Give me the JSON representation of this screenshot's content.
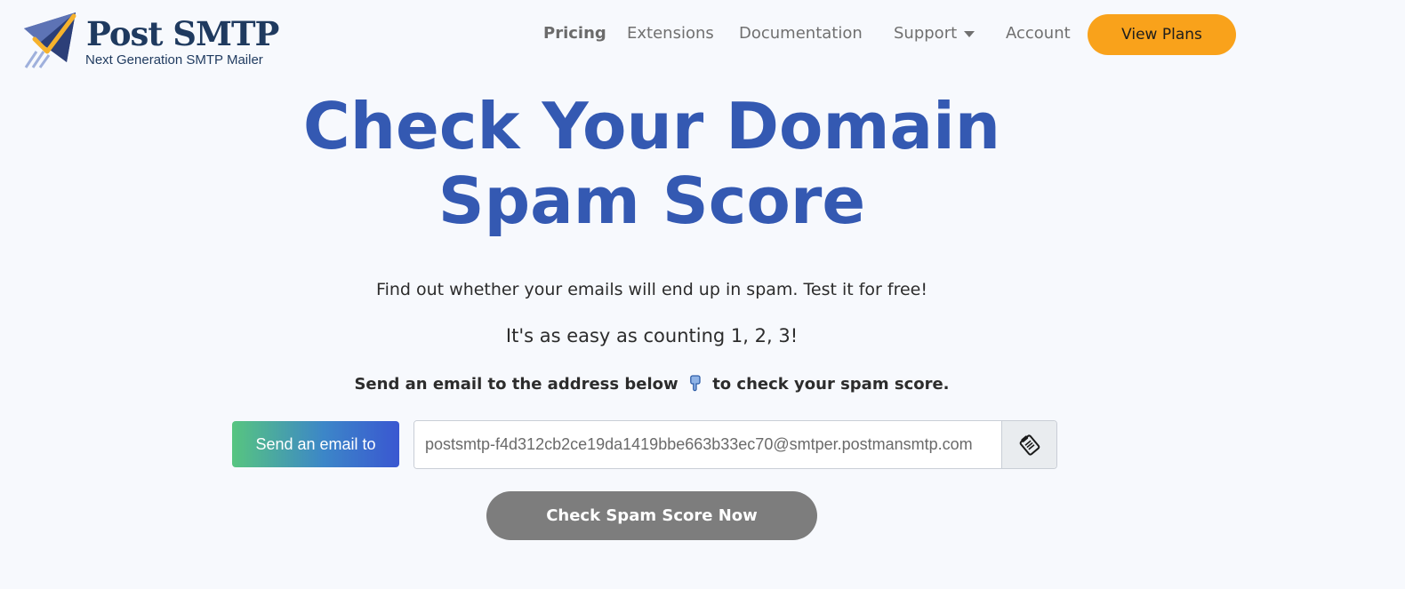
{
  "logo": {
    "title": "Post SMTP",
    "tagline": "Next Generation SMTP Mailer"
  },
  "nav": {
    "items": [
      {
        "label": "Pricing"
      },
      {
        "label": "Extensions"
      },
      {
        "label": "Documentation"
      },
      {
        "label": "Support"
      },
      {
        "label": "Account"
      }
    ],
    "cta": "View Plans"
  },
  "hero": {
    "title_line1": "Check Your Domain",
    "title_line2": "Spam Score",
    "subtitle": "Find out whether your emails will end up in spam. Test it for free!",
    "easy": "It's as easy as counting 1, 2, 3!",
    "instruction_before": "Send an email to the address below",
    "instruction_after": "to check your spam score."
  },
  "form": {
    "send_label": "Send an email to",
    "email_value": "postsmtp-f4d312cb2ce19da1419bbe663b33ec70@smtper.postmansmtp.com",
    "check_button": "Check Spam Score Now"
  },
  "colors": {
    "accent": "#3459b2",
    "cta": "#f9a21b",
    "button_gray": "#7d7d7d",
    "background": "#f7f9fd"
  },
  "icons": {
    "logo": "paper-plane-logo-icon",
    "hand": "hand-pointing-down-icon",
    "copy": "copy-clipboard-icon",
    "caret": "chevron-down-icon"
  }
}
